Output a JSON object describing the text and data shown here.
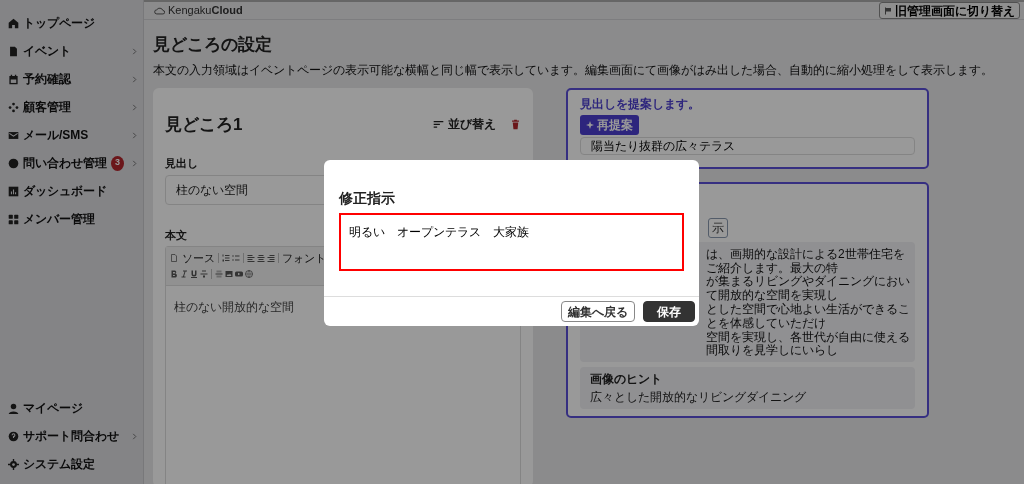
{
  "sidebar": {
    "items": [
      {
        "label": "トップページ",
        "has_submenu": false
      },
      {
        "label": "イベント",
        "has_submenu": true
      },
      {
        "label": "予約確認",
        "has_submenu": true
      },
      {
        "label": "顧客管理",
        "has_submenu": true
      },
      {
        "label": "メール/SMS",
        "has_submenu": true
      },
      {
        "label": "問い合わせ管理",
        "has_submenu": true,
        "badge": "3"
      },
      {
        "label": "ダッシュボード",
        "has_submenu": false
      },
      {
        "label": "メンバー管理",
        "has_submenu": false
      }
    ],
    "bottom_items": [
      {
        "label": "マイページ",
        "has_submenu": false
      },
      {
        "label": "サポート問合わせ",
        "has_submenu": true
      },
      {
        "label": "システム設定",
        "has_submenu": false
      }
    ]
  },
  "header": {
    "logo": "Kengaku**Cloud**",
    "switch_button": "旧管理画面に切り替え"
  },
  "page": {
    "title": "見どころの設定",
    "description": "本文の入力領域はイベントページの表示可能な横幅と同じ幅で表示しています。編集画面にて画像がはみ出した場合、自動的に縮小処理をして表示します。"
  },
  "highlight_card": {
    "title": "見どころ1",
    "sort_button": "並び替え",
    "heading_label": "見出し",
    "heading_value": "柱のない空間",
    "body_label": "本文",
    "toolbar": {
      "source": "ソース",
      "font": "フォント"
    },
    "body_text": "柱のない開放的な空間"
  },
  "suggest_card": {
    "title": "見出しを提案します。",
    "regenerate_button": "再提案",
    "suggestion": "陽当たり抜群の広々テラス"
  },
  "body_card": {
    "button_fragment": "示",
    "text_fragments": [
      "は、画期的な設計による2世帯住宅をご紹介します。最大の特",
      "が集まるリビングやダイニングにおいて開放的な空間を実現し",
      "とした空間で心地よい生活ができることを体感していただけ",
      "空間を実現し、各世代が自由に使える間取りを見学しにいらし"
    ],
    "image_hint_label": "画像のヒント",
    "image_hint": "広々とした開放的なリビングダイニング"
  },
  "modal": {
    "title": "修正指示",
    "instruction": "明るい　オープンテラス　大家族",
    "buttons": [
      {
        "label": "編集へ戻る",
        "kind": "outline"
      },
      {
        "label": "保存",
        "kind": "primary"
      }
    ]
  }
}
